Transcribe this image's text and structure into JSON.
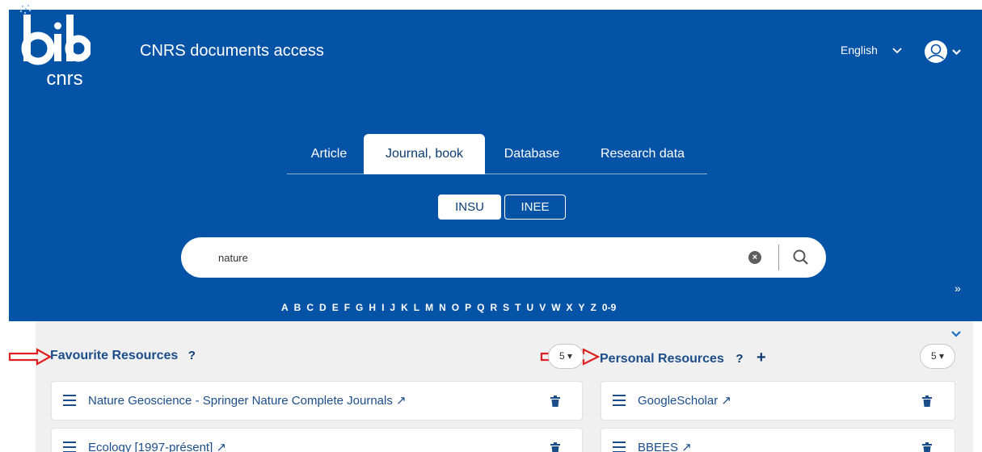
{
  "header": {
    "logo_top": "bib",
    "logo_bottom": "cnrs",
    "app_title": "CNRS documents access",
    "language": "English",
    "icons": {
      "language_toggle": "chevron-down-icon",
      "user": "user-circle-icon"
    }
  },
  "search_tabs": [
    {
      "label": "Article",
      "active": false
    },
    {
      "label": "Journal, book",
      "active": true
    },
    {
      "label": "Database",
      "active": false
    },
    {
      "label": "Research data",
      "active": false
    }
  ],
  "institutes": [
    {
      "label": "INSU",
      "active": true
    },
    {
      "label": "INEE",
      "active": false
    }
  ],
  "search": {
    "value": "nature",
    "clear_icon": "clear-icon",
    "submit_icon": "search-icon"
  },
  "alphabet": [
    "A",
    "B",
    "C",
    "D",
    "E",
    "F",
    "G",
    "H",
    "I",
    "J",
    "K",
    "L",
    "M",
    "N",
    "O",
    "P",
    "Q",
    "R",
    "S",
    "T",
    "U",
    "V",
    "W",
    "X",
    "Y",
    "Z",
    "0-9"
  ],
  "favourite_resources": {
    "title": "Favourite Resources",
    "help": "?",
    "count": "5",
    "items": [
      {
        "label": "Nature Geoscience - Springer Nature Complete Journals"
      },
      {
        "label": "Ecology [1997-présent]"
      }
    ]
  },
  "personal_resources": {
    "title": "Personal Resources",
    "help": "?",
    "add": "+",
    "count": "5",
    "items": [
      {
        "label": "GoogleScholar"
      },
      {
        "label": "BBEES"
      }
    ]
  },
  "colors": {
    "brand_blue": "#0553a6",
    "title_blue": "#1b4d8a",
    "annotation_red": "#e02020",
    "panel_bg": "#f0f0f0"
  }
}
